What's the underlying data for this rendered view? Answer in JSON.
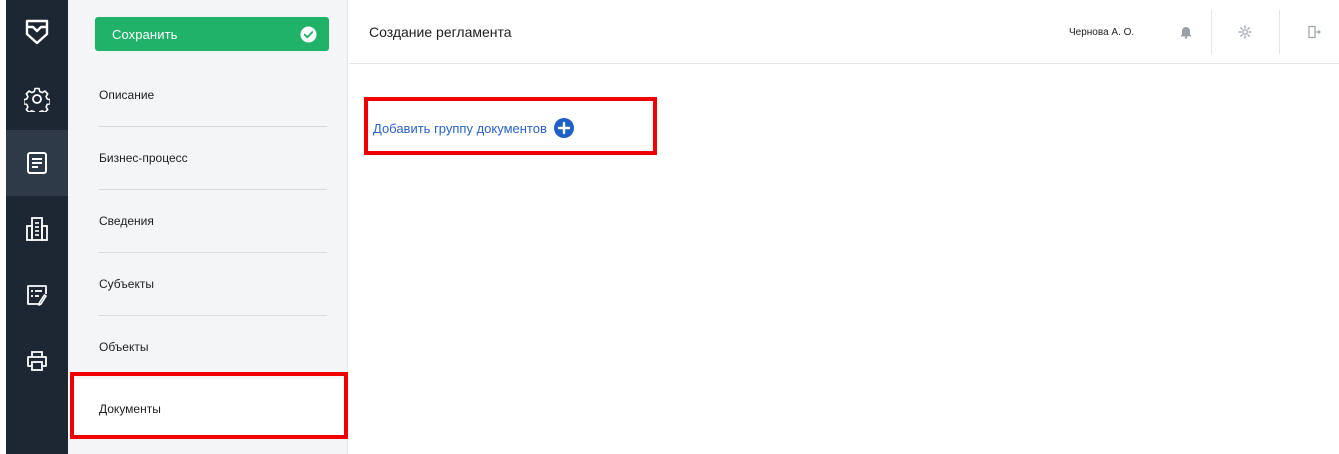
{
  "header": {
    "title": "Создание регламента",
    "user_name": "Чернова А. О."
  },
  "toolbar": {
    "save_label": "Сохранить"
  },
  "rail": {
    "items": [
      {
        "icon": "gear-icon"
      },
      {
        "icon": "document-icon",
        "active": true
      },
      {
        "icon": "building-icon"
      },
      {
        "icon": "edit-list-icon"
      },
      {
        "icon": "printer-icon"
      }
    ]
  },
  "sidebar": {
    "items": [
      {
        "label": "Описание"
      },
      {
        "label": "Бизнес-процесс"
      },
      {
        "label": "Сведения"
      },
      {
        "label": "Субъекты"
      },
      {
        "label": "Объекты"
      },
      {
        "label": "Документы",
        "active": true
      }
    ]
  },
  "main": {
    "add_group_label": "Добавить группу документов"
  },
  "colors": {
    "rail_bg": "#1d2633",
    "save_green": "#21b26a",
    "link_blue": "#2a62c9",
    "highlight_red": "#f00000"
  }
}
